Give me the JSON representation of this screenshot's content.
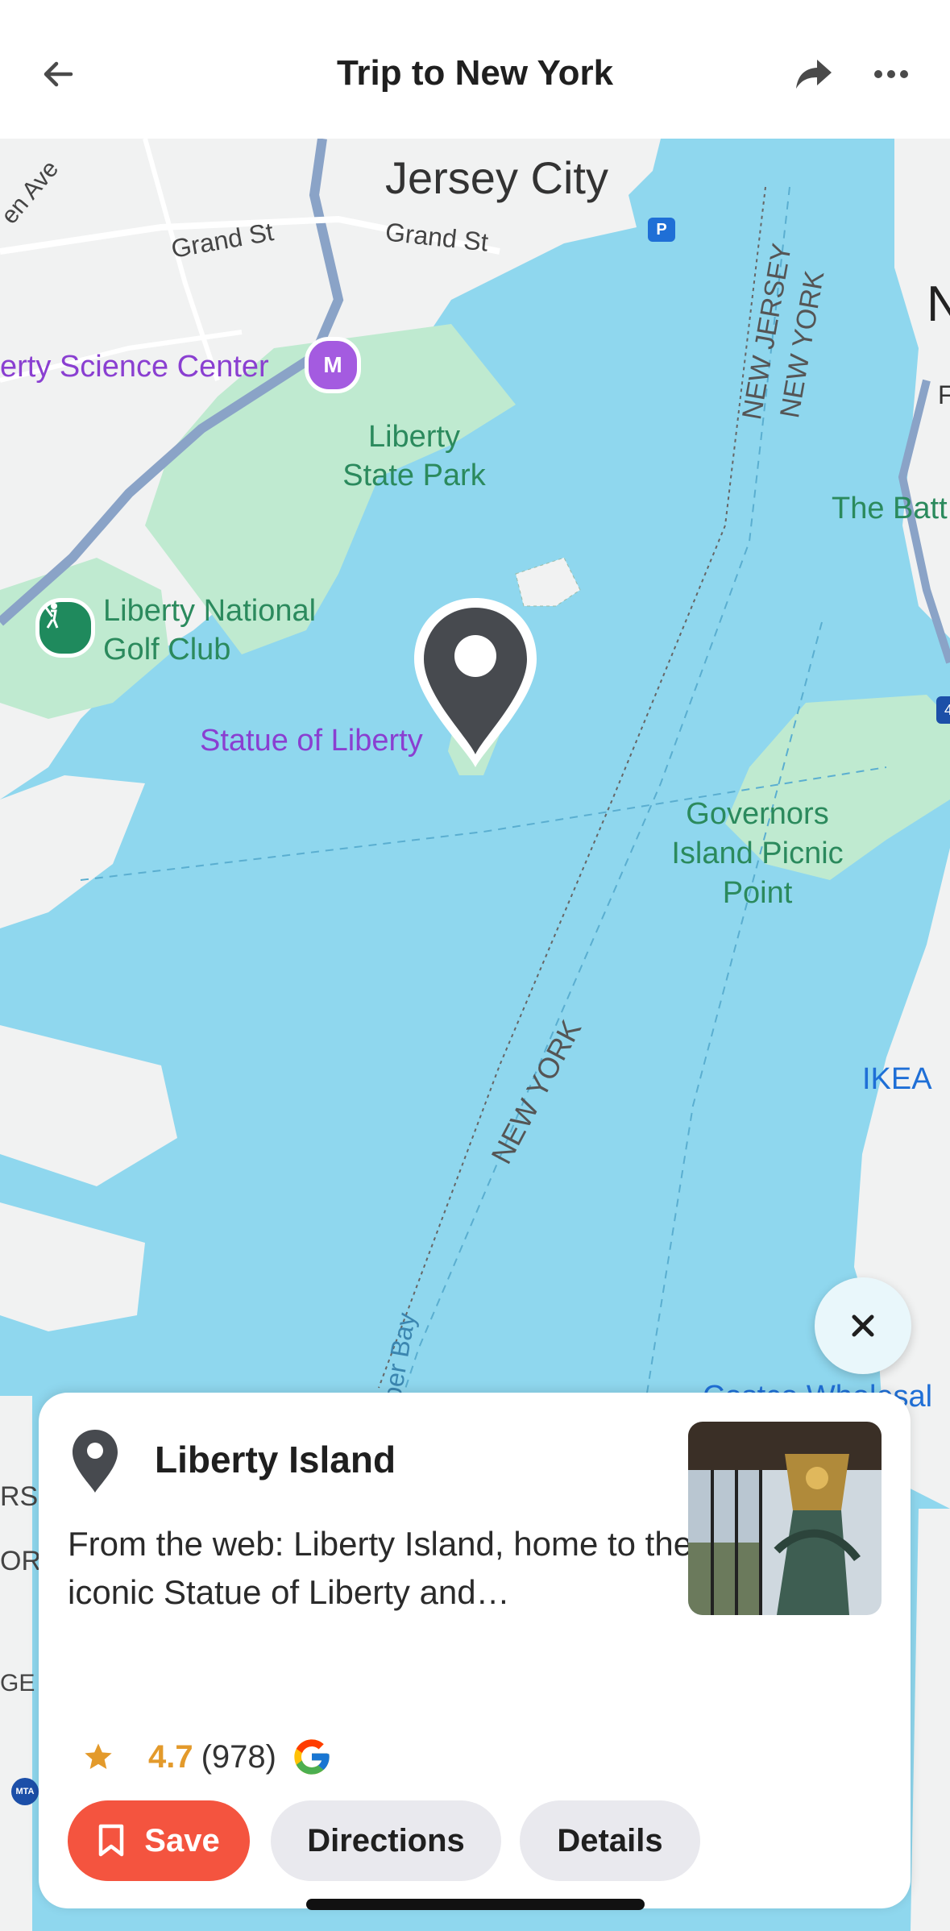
{
  "header": {
    "title": "Trip to New York",
    "back_icon": "arrow-left-icon",
    "share_icon": "share-arrow-icon",
    "more_icon": "more-horizontal-icon"
  },
  "map": {
    "labels": {
      "jersey_city": "Jersey City",
      "grand_st_1": "Grand St",
      "grand_st_2": "Grand St",
      "glen_ave": "en Ave",
      "science_center": "erty Science Center",
      "liberty_state_park": "Liberty State Park",
      "golf_club": "Liberty National Golf Club",
      "statue": "Statue of Liberty",
      "nj_ny_1": "NEW JERSEY",
      "nj_ny_2": "NEW YORK",
      "the_batt": "The Batt",
      "governors": "Governors Island Picnic Point",
      "ikea": "IKEA",
      "new_york_water": "NEW YORK",
      "upper_bay": "pper Bay",
      "costco": "Costco Wholesal",
      "edge_rs": "RS",
      "edge_or": "OR",
      "edge_ge": "GE",
      "edge_n": "N",
      "edge_f": "F",
      "mta": "MTA",
      "route_4": "4"
    },
    "colors": {
      "water": "#8fd7ee",
      "land": "#f1f2f2",
      "park": "#bfead0",
      "road": "#ffffff",
      "highway": "#8aa3c7",
      "purple_label": "#8a3fd1",
      "green_label": "#2b8a5d",
      "blue_label": "#1f6fd6"
    },
    "close_button_icon": "close-icon"
  },
  "card": {
    "pin_icon": "map-pin-icon",
    "title": "Liberty Island",
    "description": "From the web: Liberty Island, home to the iconic Statue of Liberty and…",
    "photo_icon": "place-photo",
    "rating": "4.7",
    "rating_count": "(978)",
    "star_icon": "star-icon",
    "source_icon": "google-g-icon",
    "buttons": {
      "save": "Save",
      "directions": "Directions",
      "details": "Details"
    },
    "save_icon": "bookmark-icon",
    "accent": "#f4543f",
    "rating_color": "#e39a2b"
  }
}
